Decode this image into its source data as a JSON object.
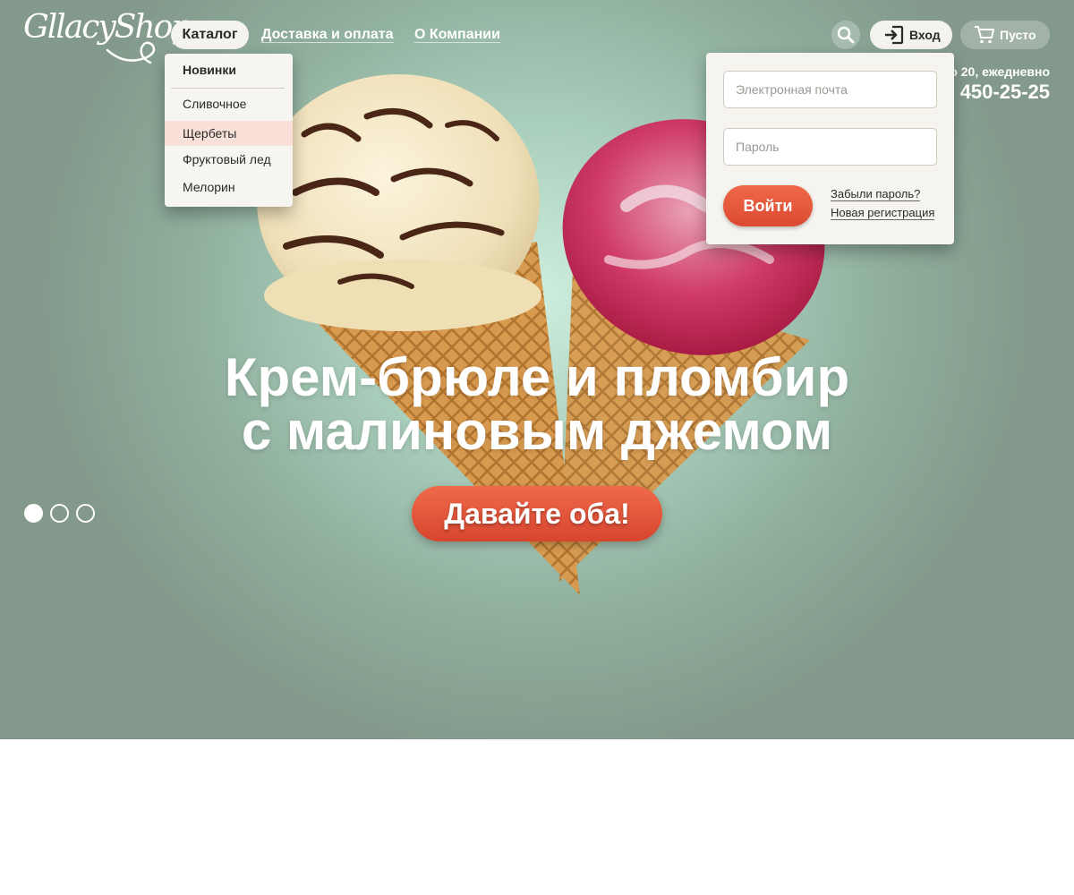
{
  "brand": {
    "logo_text": "GllacyShop"
  },
  "nav": {
    "catalog": "Каталог",
    "delivery": "Доставка и оплата",
    "about": "О Компании"
  },
  "catalog_menu": {
    "heading": "Новинки",
    "items": [
      {
        "label": "Сливочное",
        "active": false
      },
      {
        "label": "Щербеты",
        "active": true
      },
      {
        "label": "Фруктовый лед",
        "active": false
      },
      {
        "label": "Мелорин",
        "active": false
      }
    ]
  },
  "header_actions": {
    "search_icon": "search-icon",
    "login_label": "Вход",
    "login_icon": "sign-in-icon",
    "cart_label": "Пусто",
    "cart_icon": "cart-icon"
  },
  "contacts": {
    "hours": "о 20, ежедневно",
    "phone": "450-25-25"
  },
  "login_form": {
    "email_placeholder": "Электронная почта",
    "email_value": "",
    "password_placeholder": "Пароль",
    "password_value": "",
    "submit_label": "Войти",
    "forgot_link": "Забыли пароль?",
    "register_link": "Новая регистрация"
  },
  "hero": {
    "title_line1": "Крем-брюле и пломбир",
    "title_line2": "с малиновым джемом",
    "cta_label": "Давайте оба!",
    "slides_total": 3,
    "active_slide": 1
  },
  "colors": {
    "accent": "#e2523a",
    "hero_bg": "#8fae9c",
    "panel_bg": "#f6f4ef",
    "active_menu_bg": "#f9e0d9"
  }
}
